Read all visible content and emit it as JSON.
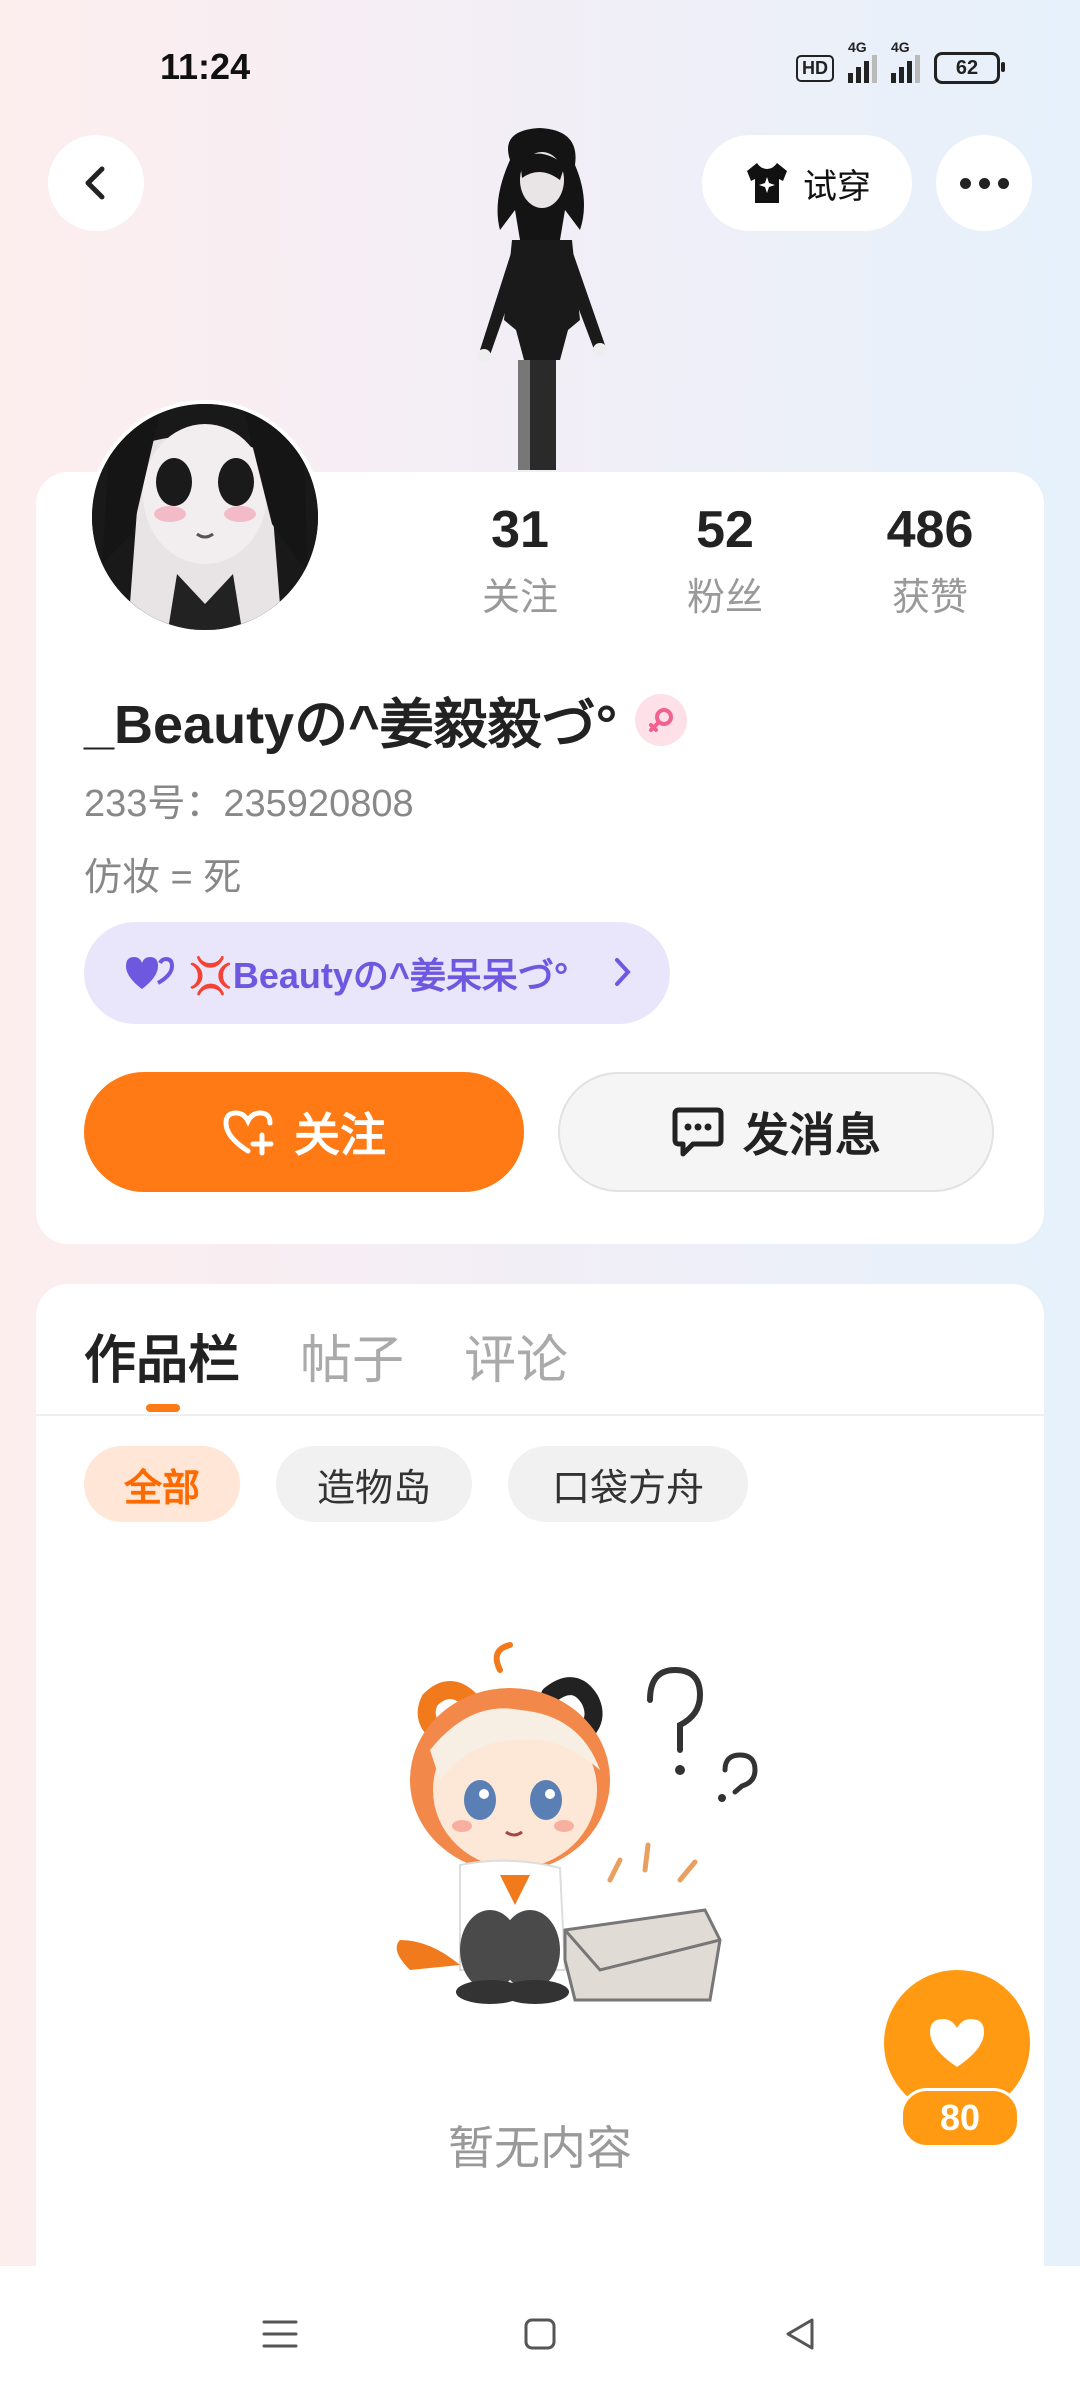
{
  "status_bar": {
    "time": "11:24",
    "hd_label": "HD",
    "network1": "4G",
    "network2": "4G",
    "battery": "62"
  },
  "top_bar": {
    "tryon_label": "试穿"
  },
  "profile": {
    "stats": [
      {
        "value": "31",
        "label": "关注"
      },
      {
        "value": "52",
        "label": "粉丝"
      },
      {
        "value": "486",
        "label": "获赞"
      }
    ],
    "username": "_Beautyの^姜毅毅づ°",
    "uid": "233号：235920808",
    "bio": "仿妆 = 死",
    "fan_tag": "💢Beautyの^姜呆呆づ°",
    "follow_label": "关注",
    "message_label": "发消息"
  },
  "content": {
    "tabs": [
      "作品栏",
      "帖子",
      "评论"
    ],
    "filters": [
      "全部",
      "造物岛",
      "口袋方舟"
    ],
    "empty_text": "暂无内容",
    "like_count": "80"
  },
  "colors": {
    "accent": "#ff7a14",
    "fan_tag_bg": "#e9e6fb",
    "fan_tag_text": "#6f58e0"
  }
}
